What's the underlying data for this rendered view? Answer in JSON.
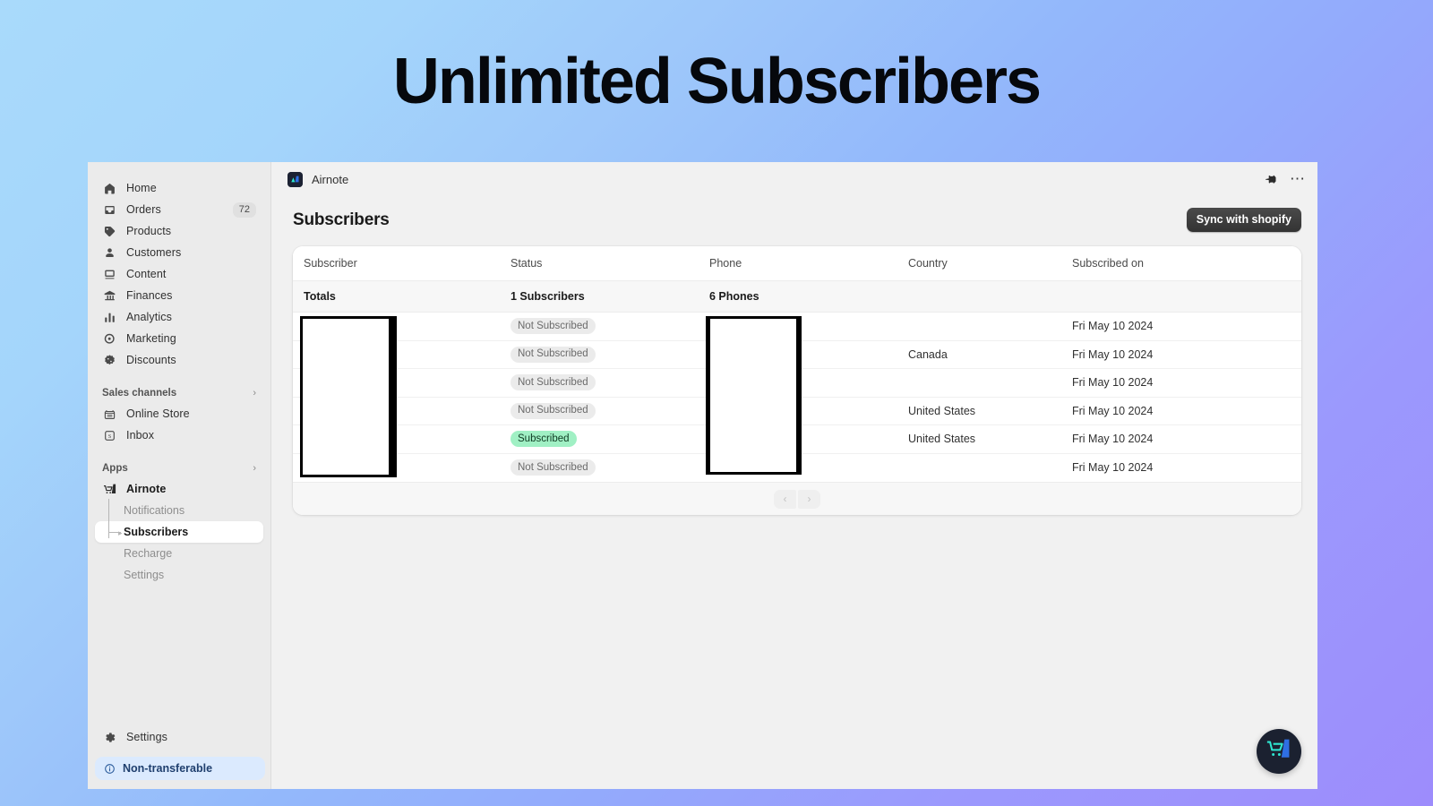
{
  "hero": {
    "title": "Unlimited Subscribers"
  },
  "sidebar": {
    "items": [
      {
        "label": "Home",
        "icon": "home-icon",
        "badge": ""
      },
      {
        "label": "Orders",
        "icon": "orders-icon",
        "badge": "72"
      },
      {
        "label": "Products",
        "icon": "products-icon",
        "badge": ""
      },
      {
        "label": "Customers",
        "icon": "customers-icon",
        "badge": ""
      },
      {
        "label": "Content",
        "icon": "content-icon",
        "badge": ""
      },
      {
        "label": "Finances",
        "icon": "finances-icon",
        "badge": ""
      },
      {
        "label": "Analytics",
        "icon": "analytics-icon",
        "badge": ""
      },
      {
        "label": "Marketing",
        "icon": "marketing-icon",
        "badge": ""
      },
      {
        "label": "Discounts",
        "icon": "discounts-icon",
        "badge": ""
      }
    ],
    "sales_channels": {
      "title": "Sales channels",
      "items": [
        {
          "label": "Online Store",
          "icon": "store-icon"
        },
        {
          "label": "Inbox",
          "icon": "inbox-icon"
        }
      ]
    },
    "apps": {
      "title": "Apps",
      "app_name": "Airnote",
      "sub_items": [
        {
          "label": "Notifications",
          "active": false
        },
        {
          "label": "Subscribers",
          "active": true
        },
        {
          "label": "Recharge",
          "active": false
        },
        {
          "label": "Settings",
          "active": false
        }
      ]
    },
    "settings": {
      "label": "Settings",
      "icon": "gear-icon"
    },
    "banner": {
      "label": "Non-transferable",
      "icon": "info-icon"
    }
  },
  "topbar": {
    "app_name": "Airnote",
    "pin_icon": "pin-icon",
    "more_icon": "more-horizontal-icon"
  },
  "page": {
    "title": "Subscribers",
    "sync_button": "Sync with shopify"
  },
  "table": {
    "columns": [
      "Subscriber",
      "Status",
      "Phone",
      "Country",
      "Subscribed on"
    ],
    "totals": {
      "label": "Totals",
      "subscribers": "1 Subscribers",
      "phones": "6 Phones",
      "country": "",
      "subscribed_on": ""
    },
    "rows": [
      {
        "subscriber": "",
        "status": "Not Subscribed",
        "status_type": "gray",
        "phone": "",
        "country": "",
        "subscribed_on": "Fri May 10 2024"
      },
      {
        "subscriber": "",
        "status": "Not Subscribed",
        "status_type": "gray",
        "phone": "",
        "country": "Canada",
        "subscribed_on": "Fri May 10 2024"
      },
      {
        "subscriber": "",
        "status": "Not Subscribed",
        "status_type": "gray",
        "phone": "",
        "country": "",
        "subscribed_on": "Fri May 10 2024"
      },
      {
        "subscriber": "",
        "status": "Not Subscribed",
        "status_type": "gray",
        "phone": "",
        "country": "United States",
        "subscribed_on": "Fri May 10 2024"
      },
      {
        "subscriber": "",
        "status": "Subscribed",
        "status_type": "green",
        "phone": "",
        "country": "United States",
        "subscribed_on": "Fri May 10 2024"
      },
      {
        "subscriber": "",
        "status": "Not Subscribed",
        "status_type": "gray",
        "phone": "",
        "country": "",
        "subscribed_on": "Fri May 10 2024"
      }
    ],
    "pagination": {
      "prev": "‹",
      "next": "›"
    }
  },
  "fab": {
    "icon": "airnote-cart-icon"
  },
  "colors": {
    "accent_green": "#a0f0c4",
    "brand_cyan": "#2ee6d0",
    "brand_blue": "#2f6fe4",
    "sync_button_bg": "#333333",
    "banner_bg": "#dbeafe"
  }
}
